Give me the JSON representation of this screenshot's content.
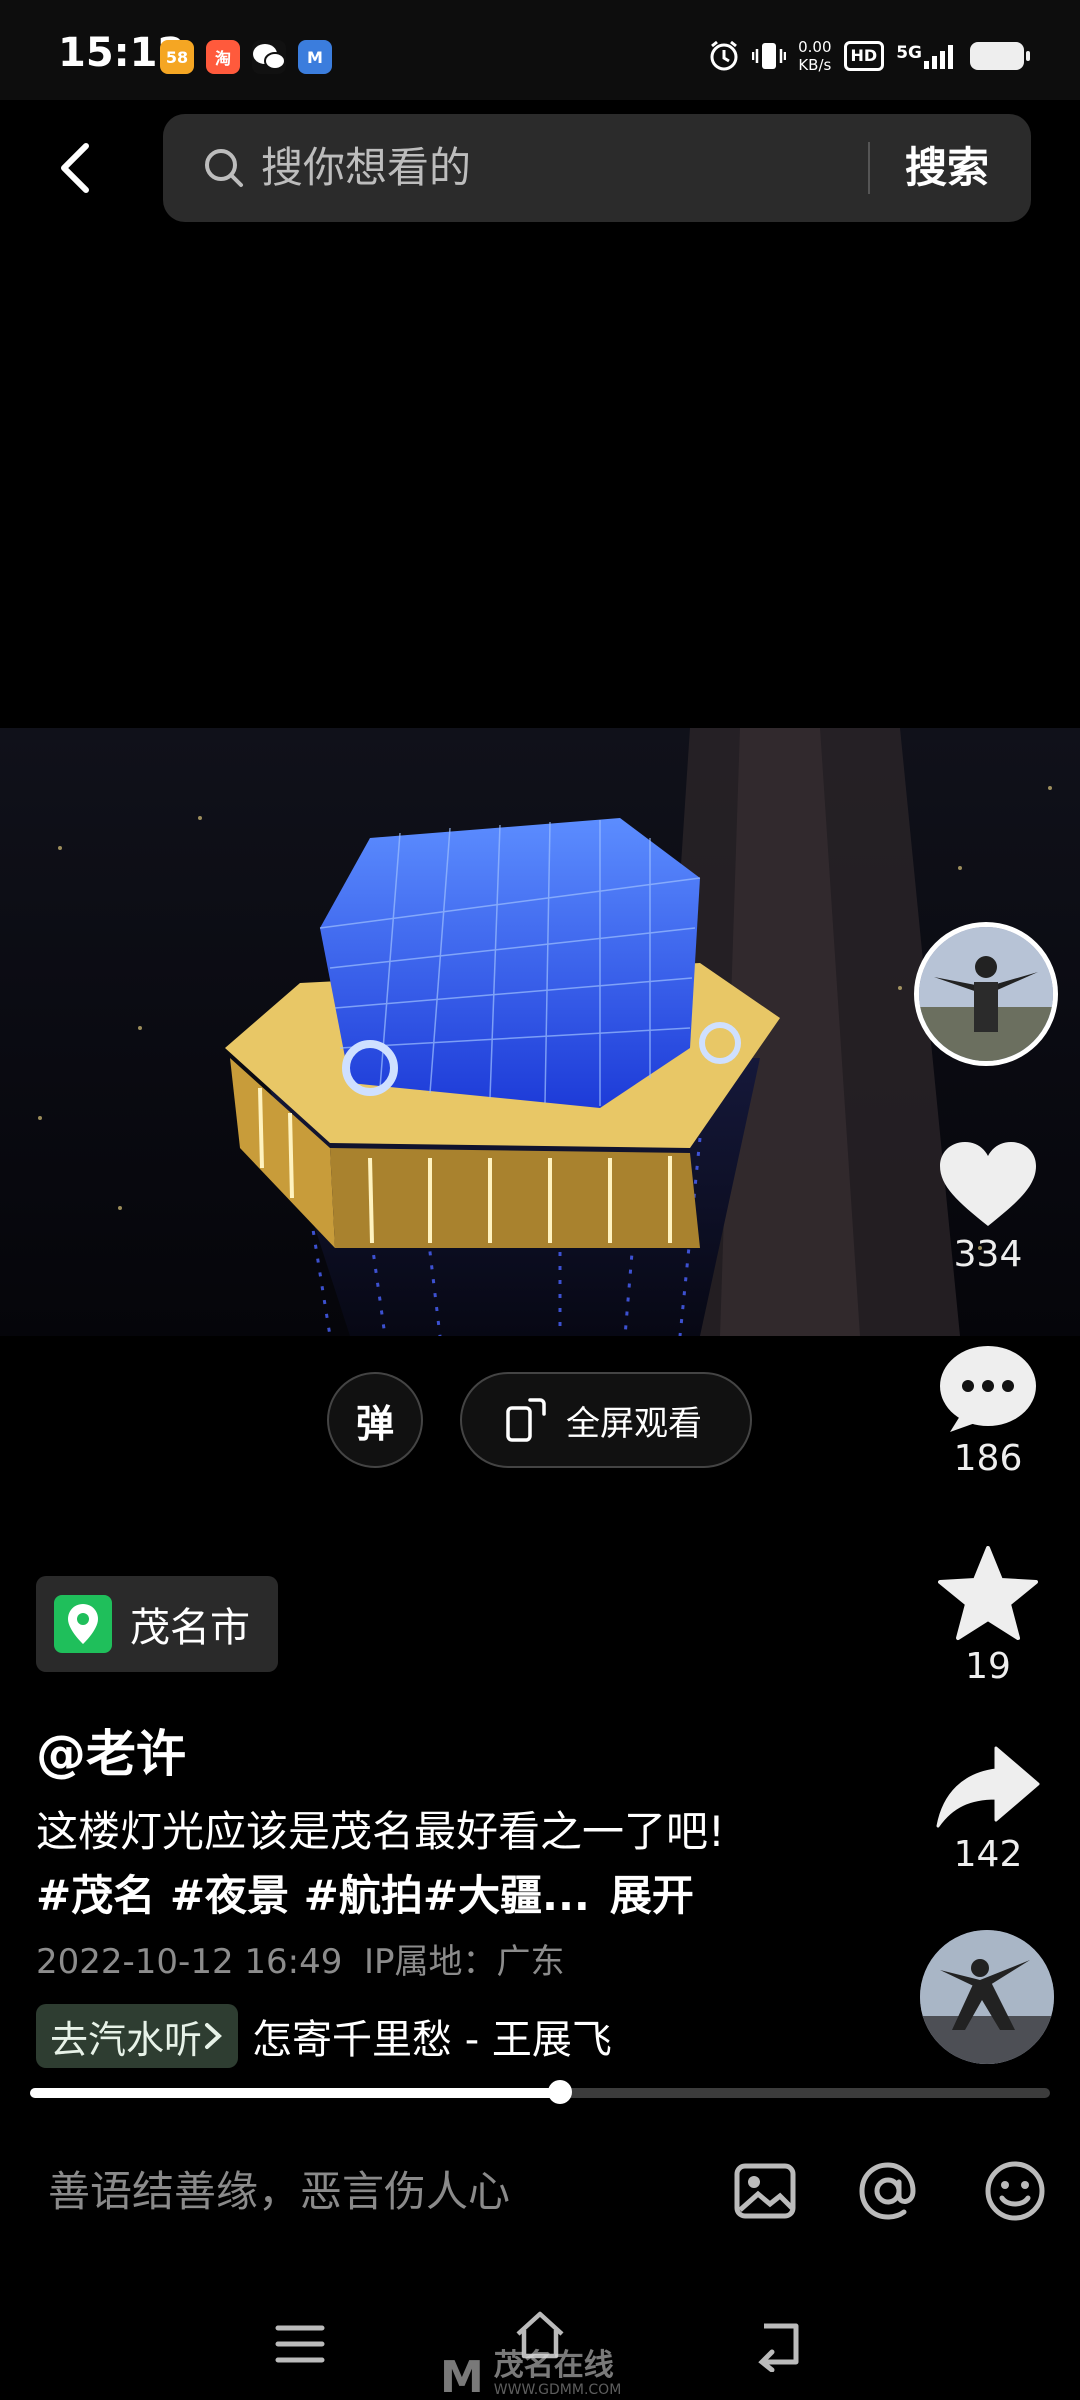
{
  "status_bar": {
    "time": "15:12",
    "apps": [
      {
        "name": "58-app-icon",
        "label": "58",
        "color": "#f5a623"
      },
      {
        "name": "shop-app-icon",
        "label": "淘",
        "color": "#ff5a3c"
      },
      {
        "name": "wechat-icon",
        "label": "",
        "color": "#2aae67"
      },
      {
        "name": "mail-app-icon",
        "label": "M",
        "color": "#3b7ddd"
      }
    ],
    "net_speed_value": "0.00",
    "net_speed_unit": "KB/s",
    "hd_label": "HD",
    "network_label": "5G"
  },
  "search": {
    "placeholder": "搜你想看的",
    "button_label": "搜索"
  },
  "video_controls": {
    "danmu_label": "弹",
    "fullscreen_label": "全屏观看"
  },
  "actions": {
    "like_count": "334",
    "comment_count": "186",
    "favorite_count": "19",
    "share_count": "142"
  },
  "post": {
    "location": "茂名市",
    "author": "@老许",
    "text": "这楼灯光应该是茂名最好看之一了吧!",
    "tags": "#茂名 #夜景 #航拍#大疆...",
    "expand_label": "展开",
    "date": "2022-10-12 16:49",
    "ip_location": "IP属地：广东"
  },
  "music": {
    "soda_label": "去汽水听",
    "song": "怎寄千里愁 - 王展飞"
  },
  "progress": {
    "fraction": 0.52
  },
  "comment_bar": {
    "placeholder": "善语结善缘，恶言伤人心"
  },
  "watermark": {
    "name": "茂名在线",
    "url": "WWW.GDMM.COM"
  },
  "colors": {
    "location_pin": "#1fbf5b",
    "background": "#000000"
  }
}
